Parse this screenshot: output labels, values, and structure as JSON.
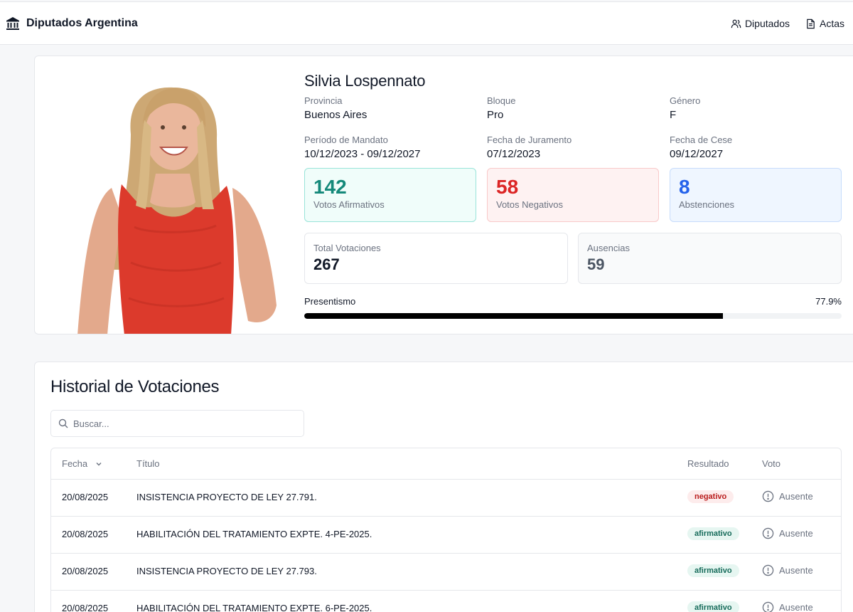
{
  "header": {
    "brand": "Diputados Argentina",
    "brand_icon": "building-columns-icon",
    "nav": [
      {
        "label": "Diputados",
        "icon": "users-icon"
      },
      {
        "label": "Actas",
        "icon": "document-icon"
      }
    ]
  },
  "profile": {
    "name": "Silvia Lospennato",
    "fields": [
      {
        "label": "Provincia",
        "value": "Buenos Aires"
      },
      {
        "label": "Bloque",
        "value": "Pro"
      },
      {
        "label": "Género",
        "value": "F"
      },
      {
        "label": "Período de Mandato",
        "value": "10/12/2023 - 09/12/2027"
      },
      {
        "label": "Fecha de Juramento",
        "value": "07/12/2023"
      },
      {
        "label": "Fecha de Cese",
        "value": "09/12/2027"
      }
    ],
    "votes": {
      "afirmativos": {
        "value": "142",
        "label": "Votos Afirmativos"
      },
      "negativos": {
        "value": "58",
        "label": "Votos Negativos"
      },
      "abstenciones": {
        "value": "8",
        "label": "Abstenciones"
      }
    },
    "totals": {
      "total": {
        "label": "Total Votaciones",
        "value": "267"
      },
      "ausencias": {
        "label": "Ausencias",
        "value": "59"
      }
    },
    "presentismo": {
      "label": "Presentismo",
      "value": "77.9%",
      "percent": 77.9
    },
    "colors": {
      "afirmativo": "#14897a",
      "negativo": "#dc2626",
      "abstencion": "#2563eb"
    }
  },
  "history": {
    "title": "Historial de Votaciones",
    "search_placeholder": "Buscar...",
    "columns": {
      "fecha": "Fecha",
      "titulo": "Título",
      "resultado": "Resultado",
      "voto": "Voto"
    },
    "rows": [
      {
        "fecha": "20/08/2025",
        "titulo": "INSISTENCIA PROYECTO DE LEY 27.791.",
        "resultado": "negativo",
        "voto": "Ausente"
      },
      {
        "fecha": "20/08/2025",
        "titulo": "HABILITACIÓN DEL TRATAMIENTO EXPTE. 4-PE-2025.",
        "resultado": "afirmativo",
        "voto": "Ausente"
      },
      {
        "fecha": "20/08/2025",
        "titulo": "INSISTENCIA PROYECTO DE LEY 27.793.",
        "resultado": "afirmativo",
        "voto": "Ausente"
      },
      {
        "fecha": "20/08/2025",
        "titulo": "HABILITACIÓN DEL TRATAMIENTO EXPTE. 6-PE-2025.",
        "resultado": "afirmativo",
        "voto": "Ausente"
      }
    ]
  }
}
